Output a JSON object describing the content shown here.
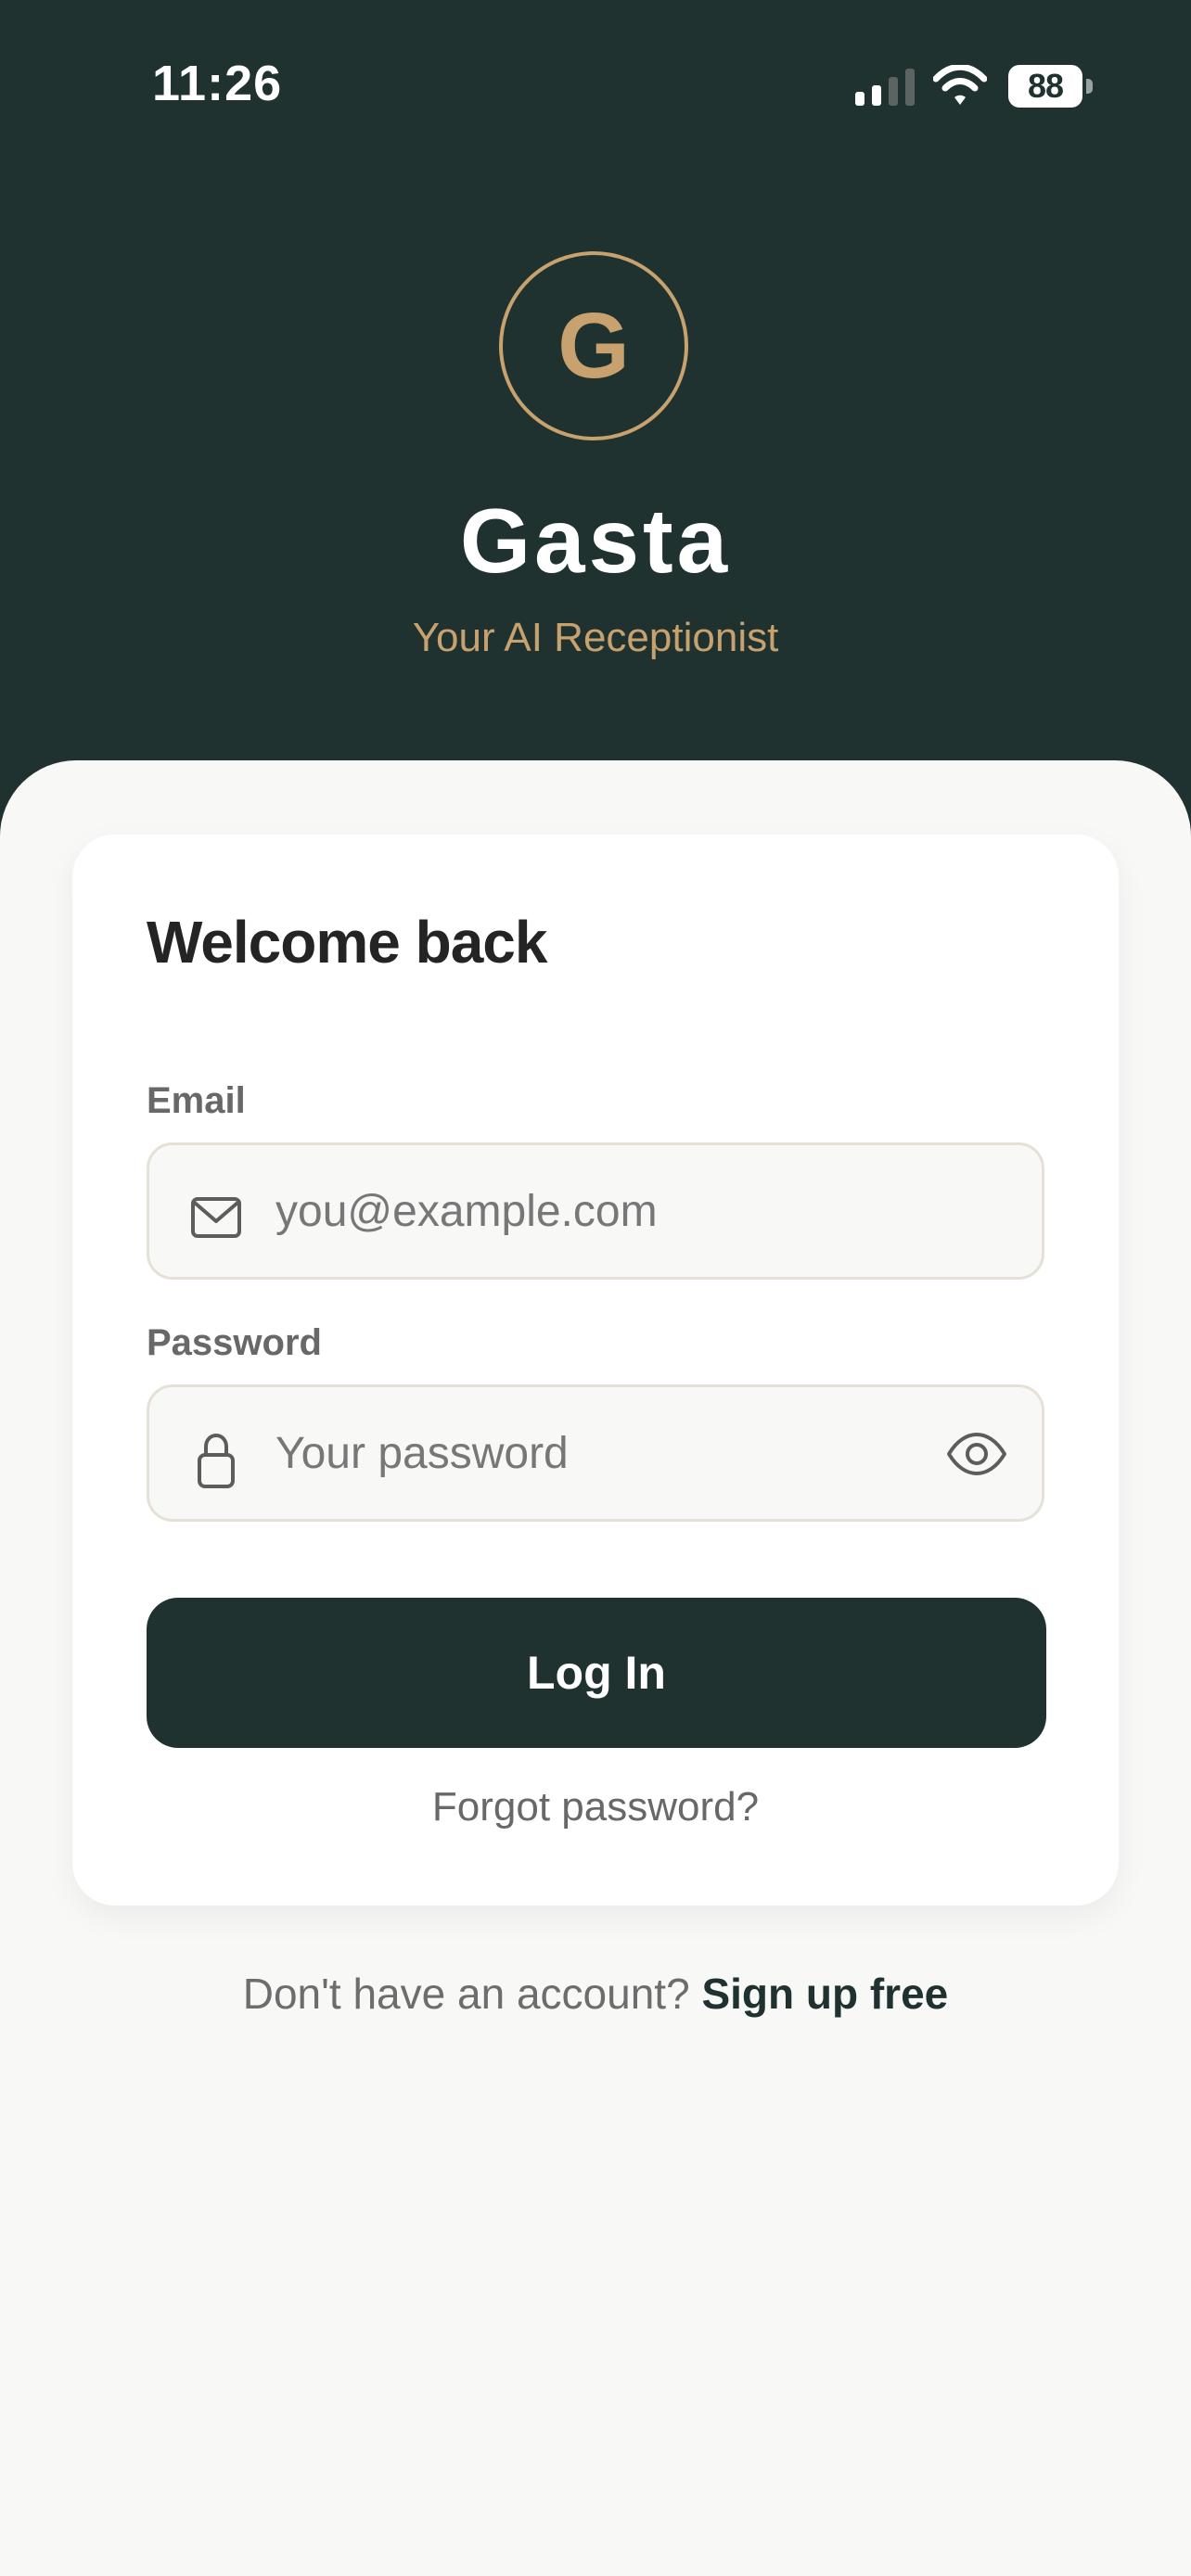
{
  "status_bar": {
    "time": "11:26",
    "battery": "88",
    "icons": {
      "signal": "signal-icon",
      "wifi": "wifi-icon",
      "battery": "battery-icon"
    }
  },
  "brand": {
    "logo_letter": "G",
    "name": "Gasta",
    "tagline": "Your AI Receptionist",
    "colors": {
      "primary": "#1f3230",
      "accent": "#c7a26e",
      "background": "#f8f8f7",
      "card": "#ffffff"
    }
  },
  "login_card": {
    "title": "Welcome back",
    "email": {
      "label": "Email",
      "placeholder": "you@example.com",
      "value": "",
      "icon": "mail-icon"
    },
    "password": {
      "label": "Password",
      "placeholder": "Your password",
      "value": "",
      "lock_icon": "lock-icon",
      "visibility_icon": "eye-icon"
    },
    "login_button": "Log In",
    "forgot_password": "Forgot password?"
  },
  "signup": {
    "prompt": "Don't have an account?",
    "link": "Sign up free"
  }
}
